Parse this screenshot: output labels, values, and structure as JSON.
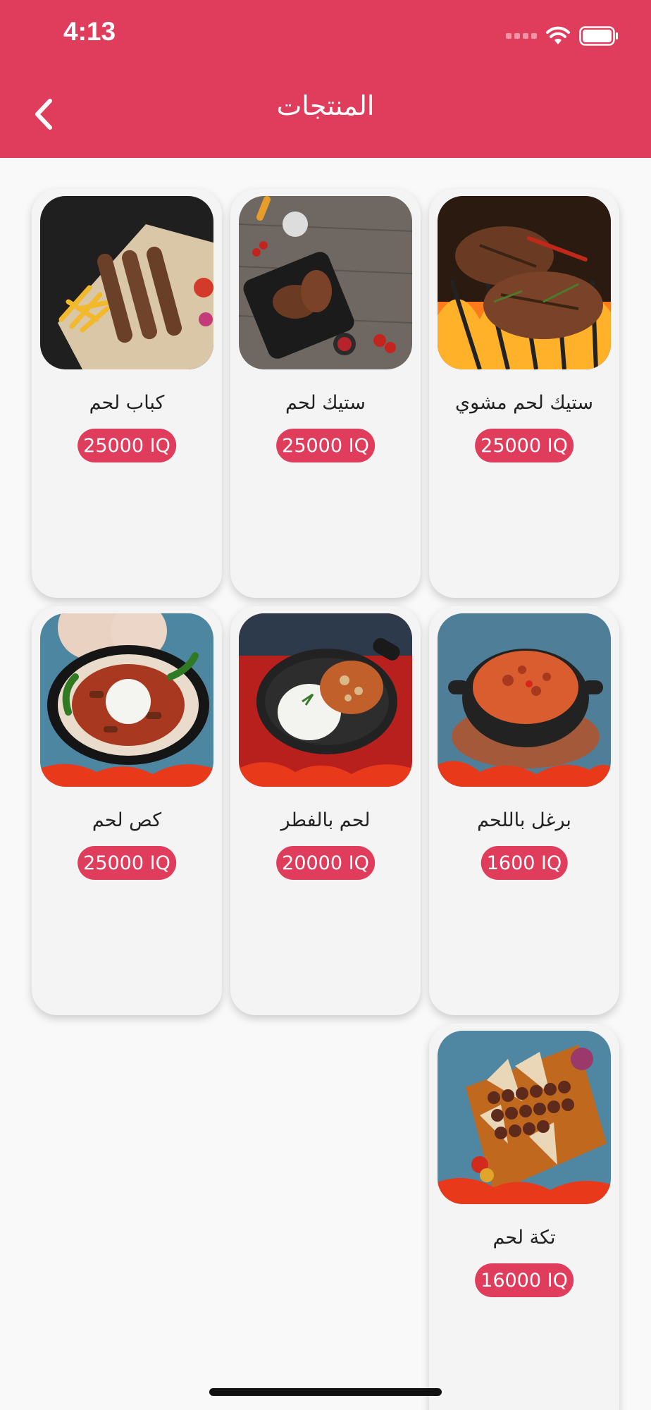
{
  "status_bar": {
    "time": "4:13"
  },
  "header": {
    "title": "المنتجات",
    "back_icon": "chevron-left-icon"
  },
  "colors": {
    "accent": "#e03c5c",
    "card_bg": "#f4f4f4",
    "page_bg": "#f9f9f9"
  },
  "products": [
    {
      "name": "ستيك لحم مشوي",
      "price": "25000 IQ",
      "image": "grilled-steak-photo"
    },
    {
      "name": "ستيك لحم",
      "price": "25000 IQ",
      "image": "steak-pan-photo"
    },
    {
      "name": "كباب لحم",
      "price": "25000 IQ",
      "image": "kebab-fries-photo"
    },
    {
      "name": "برغل باللحم",
      "price": "1600 IQ",
      "image": "bulgur-meat-photo"
    },
    {
      "name": "لحم بالفطر",
      "price": "20000 IQ",
      "image": "meat-mushroom-rice-photo"
    },
    {
      "name": "كص لحم",
      "price": "25000 IQ",
      "image": "shawarma-rice-photo"
    },
    {
      "name": "تكة لحم",
      "price": "16000 IQ",
      "image": "tikka-skewers-photo"
    }
  ]
}
